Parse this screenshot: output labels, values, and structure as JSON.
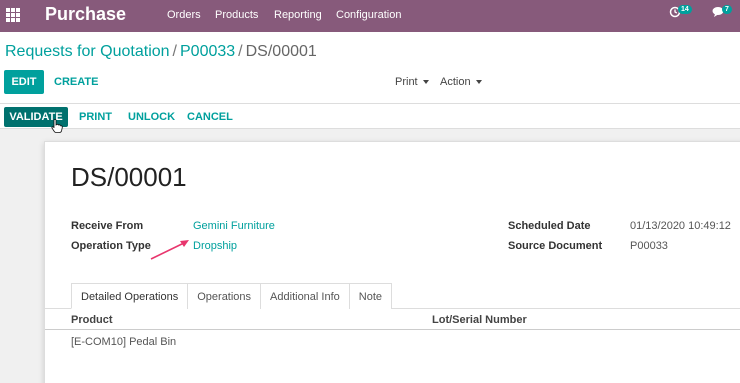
{
  "app": {
    "title": "Purchase"
  },
  "menu": [
    "Orders",
    "Products",
    "Reporting",
    "Configuration"
  ],
  "systray": {
    "activity_count": "14",
    "message_count": "7"
  },
  "breadcrumb": {
    "root": "Requests for Quotation",
    "parent": "P00033",
    "current": "DS/00001",
    "sep": "/"
  },
  "toolbar": {
    "edit": "EDIT",
    "create": "CREATE",
    "print": "Print",
    "action": "Action"
  },
  "statusbar": {
    "validate": "VALIDATE",
    "print": "PRINT",
    "unlock": "UNLOCK",
    "cancel": "CANCEL"
  },
  "form": {
    "title": "DS/00001",
    "receive_from_label": "Receive From",
    "receive_from_value": "Gemini Furniture",
    "operation_type_label": "Operation Type",
    "operation_type_value": "Dropship",
    "scheduled_date_label": "Scheduled Date",
    "scheduled_date_value": "01/13/2020 10:49:12",
    "source_document_label": "Source Document",
    "source_document_value": "P00033"
  },
  "tabs": [
    "Detailed Operations",
    "Operations",
    "Additional Info",
    "Note"
  ],
  "table": {
    "columns": [
      "Product",
      "Lot/Serial Number"
    ],
    "rows": [
      [
        "[E-COM10] Pedal Bin",
        ""
      ]
    ]
  },
  "colors": {
    "nav": "#875a7b",
    "accent": "#00a09d",
    "primary": "#00716e",
    "arrow": "#e8356d"
  }
}
